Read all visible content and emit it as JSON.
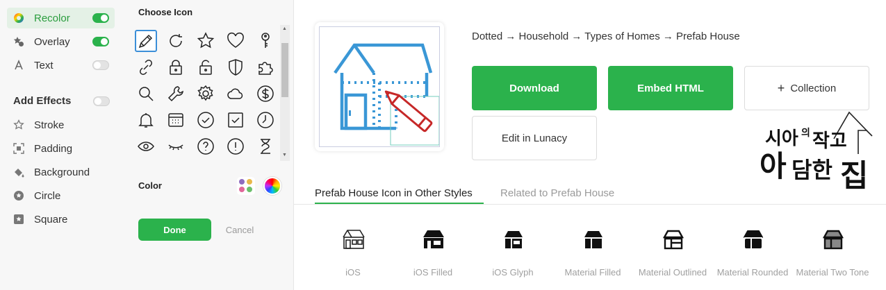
{
  "effects": {
    "items": [
      {
        "label": "Recolor",
        "toggle": "on"
      },
      {
        "label": "Overlay",
        "toggle": "on"
      },
      {
        "label": "Text",
        "toggle": "off"
      }
    ],
    "add_effects_title": "Add Effects",
    "add_effects_toggle": "off",
    "effect_list": [
      "Stroke",
      "Padding",
      "Background",
      "Circle",
      "Square"
    ]
  },
  "chooser": {
    "title": "Choose Icon",
    "icons": [
      "pencil-icon",
      "refresh-icon",
      "star-icon",
      "heart-icon",
      "key-icon",
      "link-icon",
      "lock-icon",
      "unlock-icon",
      "shield-icon",
      "puzzle-icon",
      "search-icon",
      "wrench-icon",
      "gear-icon",
      "cloud-icon",
      "dollar-icon",
      "bell-icon",
      "calendar-icon",
      "check-circle-icon",
      "checkbox-icon",
      "clock-icon",
      "eye-icon",
      "eyelash-icon",
      "question-icon",
      "exclamation-icon",
      "hourglass-icon"
    ],
    "selected_icon": "pencil-icon",
    "color_label": "Color",
    "done_label": "Done",
    "cancel_label": "Cancel"
  },
  "main": {
    "breadcrumb": "Dotted → Household → Types of Homes → Prefab House",
    "download_label": "Download",
    "embed_label": "Embed HTML",
    "collection_plus": "+",
    "collection_label": "Collection",
    "lunacy_label": "Edit in Lunacy",
    "tabs": [
      "Prefab House Icon in Other Styles",
      "Related to Prefab House"
    ],
    "styles": [
      "iOS",
      "iOS Filled",
      "iOS Glyph",
      "Material Filled",
      "Material Outlined",
      "Material Rounded",
      "Material Two Tone"
    ],
    "logo_text": "시아의작고아담한집"
  },
  "colors": {
    "accent": "#2bb24c",
    "icon_blue": "#3a97d6",
    "overlay_red": "#c62828"
  }
}
